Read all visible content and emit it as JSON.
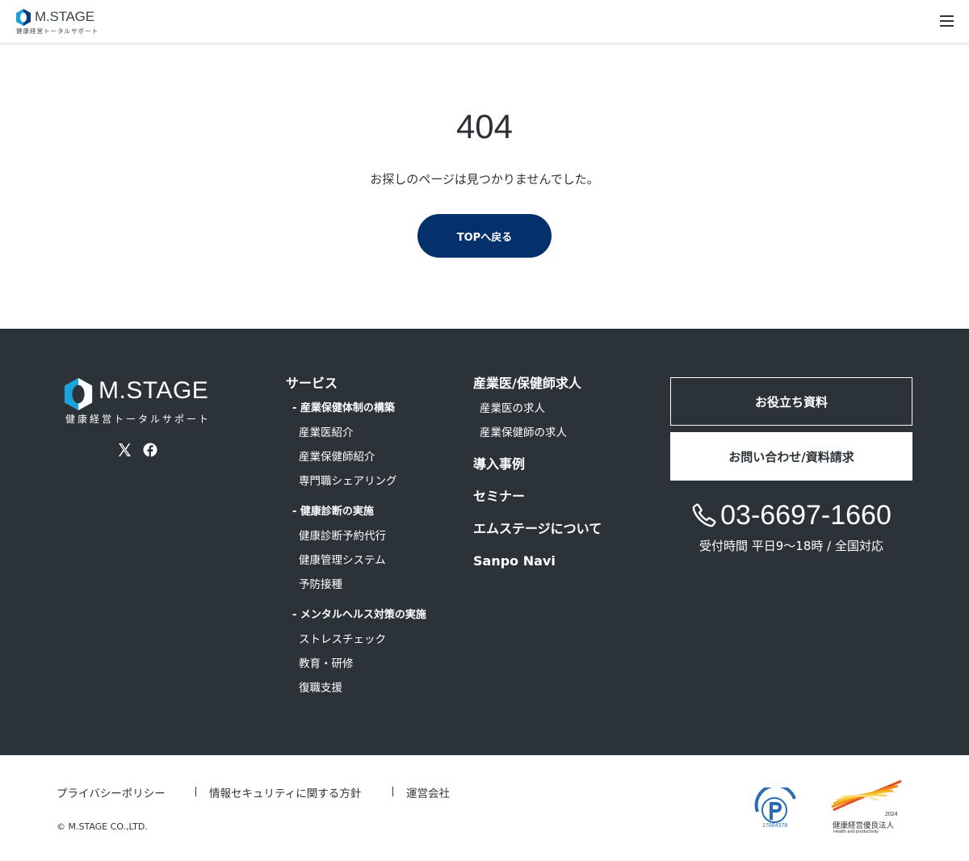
{
  "header": {
    "logo_brand": "M.STAGE",
    "logo_tagline": "健康経営トータルサポート",
    "menu_icon": "hamburger-icon"
  },
  "main": {
    "error_code": "404",
    "message": "お探しのページは見つかりませんでした。",
    "top_button": "TOPへ戻る"
  },
  "footer": {
    "logo_brand": "M.STAGE",
    "logo_tagline": "健康経営トータルサポート",
    "social": [
      "x-icon",
      "facebook-icon"
    ],
    "services": {
      "heading": "サービス",
      "groups": [
        {
          "title": "- 産業保健体制の構築",
          "items": [
            "産業医紹介",
            "産業保健師紹介",
            "専門職シェアリング"
          ]
        },
        {
          "title": "- 健康診断の実施",
          "items": [
            "健康診断予約代行",
            "健康管理システム",
            "予防接種"
          ]
        },
        {
          "title": "- メンタルヘルス対策の実施",
          "items": [
            "ストレスチェック",
            "教育・研修",
            "復職支援"
          ]
        }
      ]
    },
    "recruit": {
      "heading": "産業医/保健師求人",
      "items": [
        "産業医の求人",
        "産業保健師の求人"
      ]
    },
    "links": [
      "導入事例",
      "セミナー",
      "エムステージについて",
      "Sanpo Navi"
    ],
    "docs_button": "お役立ち資料",
    "contact_button": "お問い合わせ/資料請求",
    "phone": "03-6697-1660",
    "hours": "受付時間 平日9〜18時 / 全国対応"
  },
  "bottom": {
    "links": [
      "プライバシーポリシー",
      "情報セキュリティに関する方針",
      "運営会社"
    ],
    "copyright": "© M.STAGE CO.,LTD.",
    "pmark_number": "17004378",
    "award_year": "2024",
    "award_title": "健康経営優良法人",
    "award_sub": "Health and productivity"
  },
  "colors": {
    "primary": "#04306b",
    "footer_bg": "#2b3338",
    "logo_blue": "#1aa3dc"
  }
}
